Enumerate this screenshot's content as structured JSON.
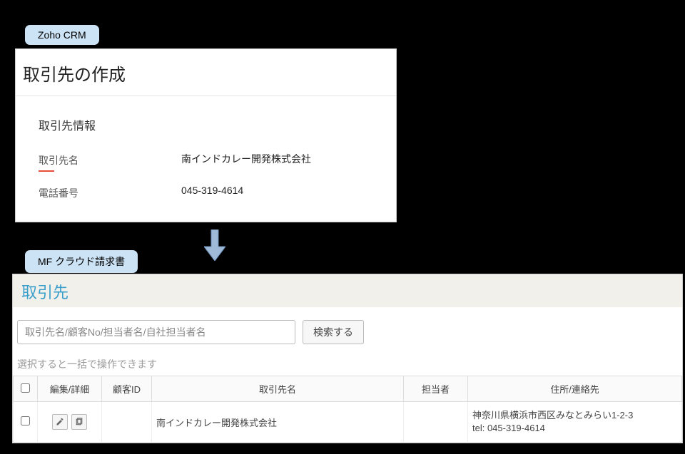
{
  "tags": {
    "zoho": "Zoho CRM",
    "mf": "MF クラウド請求書"
  },
  "zoho": {
    "title": "取引先の作成",
    "section_title": "取引先情報",
    "fields": {
      "name_label": "取引先名",
      "name_value": "南インドカレー開発株式会社",
      "phone_label": "電話番号",
      "phone_value": "045-319-4614"
    }
  },
  "mf": {
    "title": "取引先",
    "search_placeholder": "取引先名/顧客No/担当者名/自社担当者名",
    "search_button": "検索する",
    "hint": "選択すると一括で操作できます",
    "columns": {
      "edit": "編集/詳細",
      "customer_id": "顧客ID",
      "name": "取引先名",
      "person": "担当者",
      "address": "住所/連絡先"
    },
    "row": {
      "customer_id": "",
      "name": "南インドカレー開発株式会社",
      "person": "",
      "address_line": "神奈川県横浜市西区みなとみらい1-2-3",
      "tel_line": "tel: 045-319-4614"
    }
  }
}
